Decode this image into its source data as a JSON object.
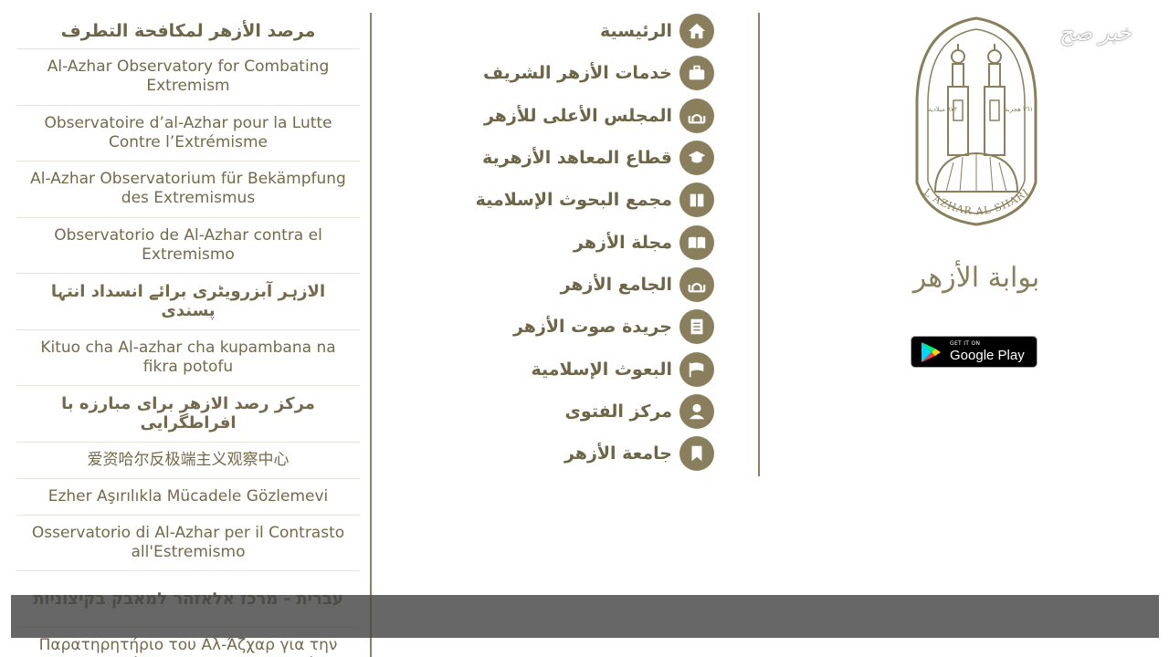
{
  "observatory": {
    "title": "مرصد الأزهر لمكافحة التطرف",
    "items": [
      {
        "label": "Al-Azhar Observatory for Combating Extremism",
        "rtl": false
      },
      {
        "label": "Observatoire d’al-Azhar pour la Lutte Contre l’Extrémisme",
        "rtl": false
      },
      {
        "label": "Al-Azhar Observatorium für Bekämpfung des Extremismus",
        "rtl": false
      },
      {
        "label": "Observatorio de Al-Azhar contra el Extremismo",
        "rtl": false
      },
      {
        "label": "الازہر آبزرویٹری برائے انسداد انتہا پسندی",
        "rtl": true
      },
      {
        "label": "Kituo cha Al-azhar cha kupambana na fikra potofu",
        "rtl": false
      },
      {
        "label": "مرکز رصد الازهر برای مبارزه با افراطگرایی",
        "rtl": true
      },
      {
        "label": "爱资哈尔反极端主义观察中心",
        "rtl": false,
        "short": true
      },
      {
        "label": "Ezher Aşırılıkla Mücadele Gözlemevi",
        "rtl": false,
        "short": true
      },
      {
        "label": "Osservatorio di Al-Azhar per il Contrasto all'Estremismo",
        "rtl": false
      },
      {
        "label": "עברית - מרכז אלאזהר למאבק בקיצוניות",
        "rtl": true
      },
      {
        "label": "Παρατηρητήριο του Αλ-Άζχαρ για την Καταπολέμηση του Εξτρεμισμού",
        "rtl": false
      }
    ]
  },
  "nav": {
    "items": [
      {
        "label": "الرئيسية",
        "icon": "home-icon"
      },
      {
        "label": "خدمات الأزهر الشريف",
        "icon": "briefcase-icon"
      },
      {
        "label": "المجلس الأعلى للأزهر",
        "icon": "mosque-icon"
      },
      {
        "label": "قطاع المعاهد الأزهرية",
        "icon": "graduation-cap-icon"
      },
      {
        "label": "مجمع البحوث الإسلامية",
        "icon": "book-icon"
      },
      {
        "label": "مجلة الأزهر",
        "icon": "open-book-icon"
      },
      {
        "label": "الجامع الأزهر",
        "icon": "mosque-icon"
      },
      {
        "label": "جريدة صوت الأزهر",
        "icon": "document-icon"
      },
      {
        "label": "البعوث الإسلامية",
        "icon": "flag-icon"
      },
      {
        "label": "مركز الفتوى",
        "icon": "user-icon"
      },
      {
        "label": "جامعة الأزهر",
        "icon": "bookmark-icon"
      }
    ]
  },
  "brand": {
    "logo_arc_text": "AL AZHAR AL SHARIF",
    "logo_year_left": "٩٧٢ ميلادية",
    "logo_year_right": "٣٦١ هجرية",
    "calligraphy": "بوابة الأزهر",
    "gplay_small": "GET IT ON",
    "gplay_big": "Google Play"
  },
  "watermark": "خبر صح",
  "colors": {
    "accent": "#8a7f5c",
    "text": "#6e6547",
    "overlay": "#464646"
  }
}
